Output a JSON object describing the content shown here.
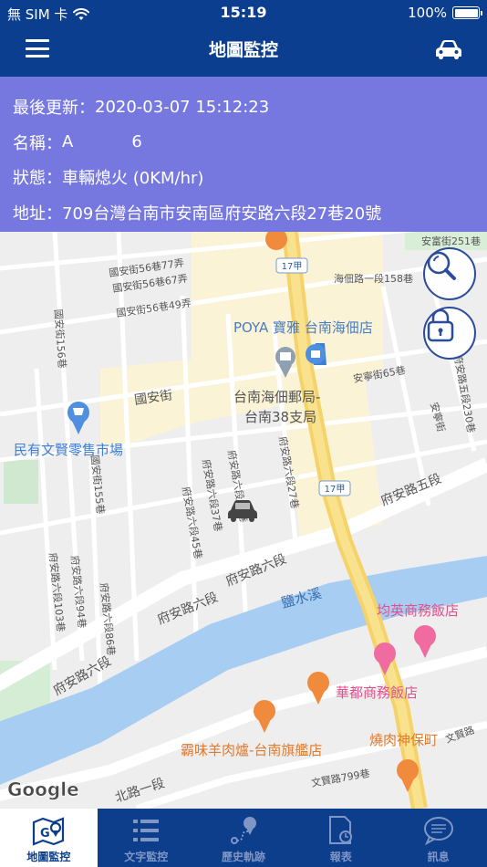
{
  "status_bar": {
    "carrier": "無 SIM 卡",
    "time": "15:19",
    "battery": "100%"
  },
  "nav": {
    "title": "地圖監控",
    "menu_icon": "hamburger-menu-icon",
    "car_icon": "car-icon"
  },
  "info": {
    "rows": [
      {
        "label": "最後更新",
        "value": "2020-03-07 15:12:23"
      },
      {
        "label": "名稱",
        "value": "A",
        "extra": "6"
      },
      {
        "label": "狀態",
        "value": "車輛熄火 (0KM/hr)"
      },
      {
        "label": "地址",
        "value": "709台灣台南市安南區府安路六段27巷20號"
      }
    ]
  },
  "map": {
    "labels": {
      "road_17a_top": "17甲",
      "road_17a_mid": "17甲",
      "anfu_251": "安富街251巷",
      "haidian_158": "海佃路一段158巷",
      "guoan_56_77": "國安街56巷77弄",
      "guoan_56_67": "國安街56巷67弄",
      "guoan_56_49": "國安街56巷49弄",
      "poya": "POYA 寶雅 台南海佃店",
      "anning_65": "安寧街65巷",
      "fuan5_230": "府安路五段230巷",
      "anning": "安寧街",
      "guoan": "國安街",
      "post_office_1": "台南海佃郵局-",
      "post_office_2": "台南38支局",
      "minyou_market": "民有文賢零售市場",
      "guoan_156": "國安街156巷",
      "guoan_155": "國安街155巷",
      "fuan6_37": "府安路六段37巷",
      "fuan6_45": "府安路六段45巷",
      "fuan6_17": "府安路六段17巷",
      "fuan6_27": "府安路六段27巷",
      "fuan5": "府安路五段",
      "fuan6_a": "府安路六段",
      "fuan6_b": "府安路六段",
      "fuan6_c": "府安路六段",
      "fuan6_103": "府安路六段103巷",
      "fuan6_94": "府安路六段94巷",
      "fuan6_86": "府安路六段86巷",
      "yanshuixi": "鹽水溪",
      "junying_hotel": "均英商務飯店",
      "huadu_hotel": "華都商務飯店",
      "roast_meat": "燒肉神保町",
      "wenxian": "文賢路",
      "bawei": "霸味羊肉爐-台南旗艦店",
      "wenxian_799": "文賢路799巷",
      "beiqu": "北路一段",
      "google": "Google"
    }
  },
  "tabs": [
    {
      "label": "地圖監控",
      "icon": "map-icon"
    },
    {
      "label": "文字監控",
      "icon": "list-icon"
    },
    {
      "label": "歷史軌跡",
      "icon": "route-icon"
    },
    {
      "label": "報表",
      "icon": "report-icon"
    },
    {
      "label": "訊息",
      "icon": "message-icon"
    }
  ]
}
